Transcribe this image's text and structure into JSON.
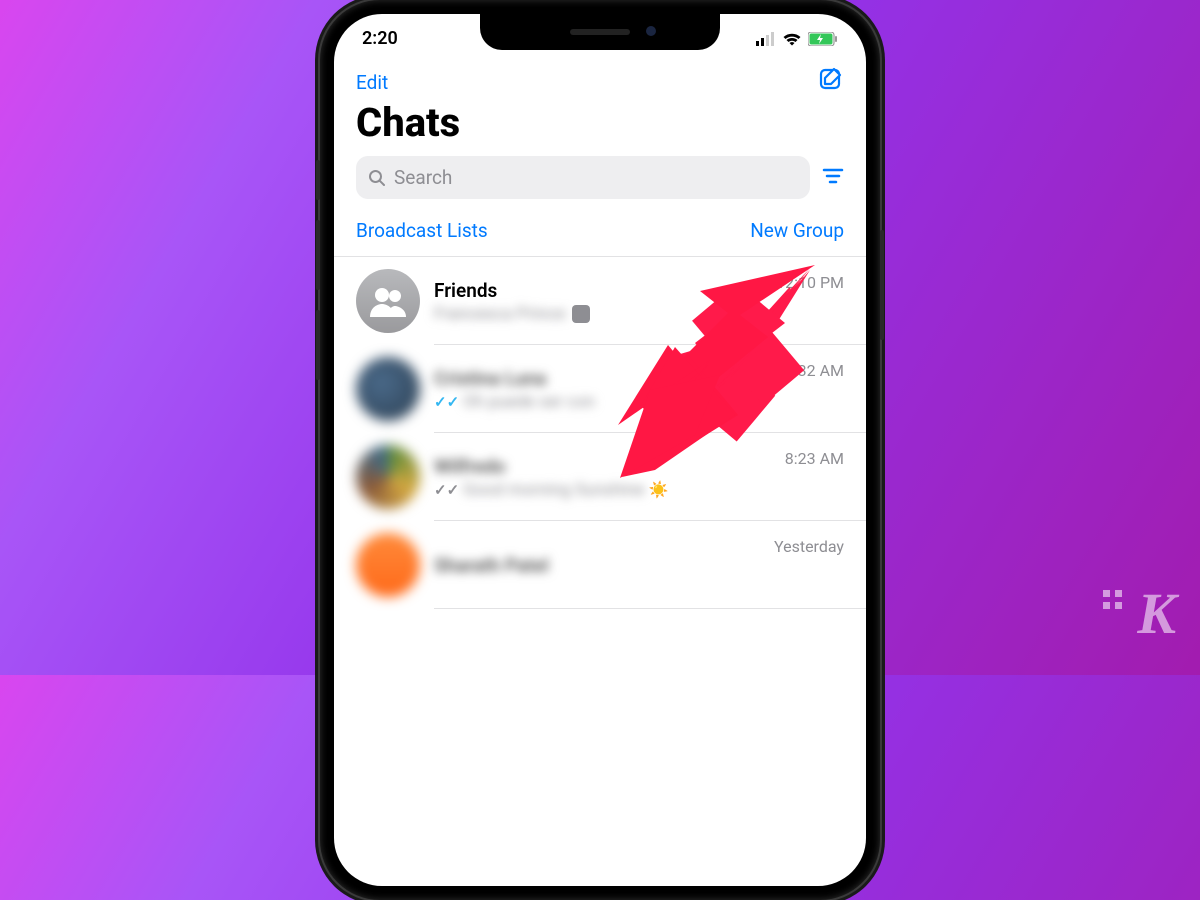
{
  "status": {
    "time": "2:20"
  },
  "nav": {
    "edit": "Edit"
  },
  "page": {
    "title": "Chats"
  },
  "search": {
    "placeholder": "Search"
  },
  "links": {
    "broadcast": "Broadcast Lists",
    "newgroup": "New Group"
  },
  "chats": [
    {
      "name": "Friends",
      "preview": "Francesca Prince:",
      "time": "12:10 PM",
      "type": "group",
      "blurred_name": false,
      "blurred_preview": true,
      "checks": "none",
      "emoji": "",
      "sticker": true
    },
    {
      "name": "Cristina Luna",
      "preview": "Oh puede ser con",
      "time": "11:32 AM",
      "type": "contact",
      "blurred_name": true,
      "blurred_preview": true,
      "checks": "blue",
      "emoji": "",
      "sticker": false
    },
    {
      "name": "Wilfredo",
      "preview": "Good morning Sunshine",
      "time": "8:23 AM",
      "type": "contact",
      "blurred_name": true,
      "blurred_preview": true,
      "checks": "gray",
      "emoji": "☀️",
      "sticker": false
    },
    {
      "name": "Sharath Patel",
      "preview": "",
      "time": "Yesterday",
      "type": "contact",
      "blurred_name": true,
      "blurred_preview": false,
      "checks": "none",
      "emoji": "",
      "sticker": false
    }
  ]
}
